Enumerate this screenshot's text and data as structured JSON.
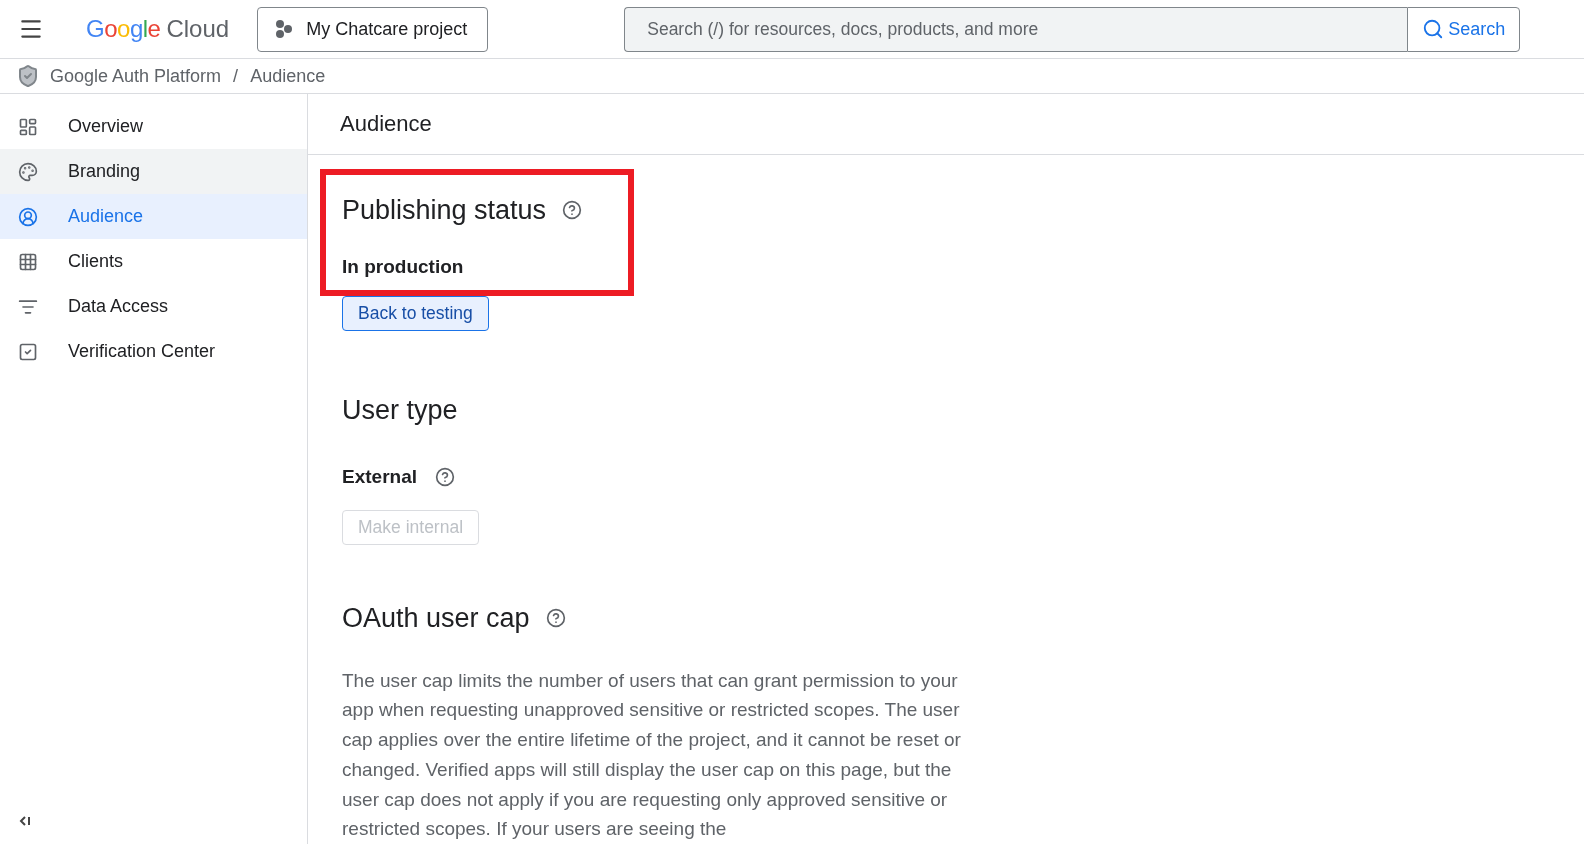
{
  "header": {
    "logo_google": "Google",
    "logo_product": "Cloud",
    "project": "My Chatcare project",
    "search": {
      "placeholder": "Search (/) for resources, docs, products, and more",
      "button": "Search"
    }
  },
  "breadcrumb": [
    "Google Auth Platform",
    "Audience"
  ],
  "breadcrumb_separator": "/",
  "sidebar": {
    "items": [
      {
        "label": "Overview",
        "selected": false,
        "hovered": false
      },
      {
        "label": "Branding",
        "selected": false,
        "hovered": true
      },
      {
        "label": "Audience",
        "selected": true,
        "hovered": false
      },
      {
        "label": "Clients",
        "selected": false,
        "hovered": false
      },
      {
        "label": "Data Access",
        "selected": false,
        "hovered": false
      },
      {
        "label": "Verification Center",
        "selected": false,
        "hovered": false
      }
    ]
  },
  "page_title": "Audience",
  "publishing": {
    "title": "Publishing status",
    "status": "In production",
    "highlighted": true,
    "button": {
      "label": "Back to testing",
      "disabled": false
    }
  },
  "user_type": {
    "title": "User type",
    "value": "External",
    "button": {
      "label": "Make internal",
      "disabled": true
    }
  },
  "user_cap": {
    "title": "OAuth user cap",
    "description": "The user cap limits the number of users that can grant permission to your app when requesting unapproved sensitive or restricted scopes. The user cap applies over the entire lifetime of the project, and it cannot be reset or changed. Verified apps will still display the user cap on this page, but the user cap does not apply if you are requesting only approved sensitive or restricted scopes. If your users are seeing the"
  }
}
